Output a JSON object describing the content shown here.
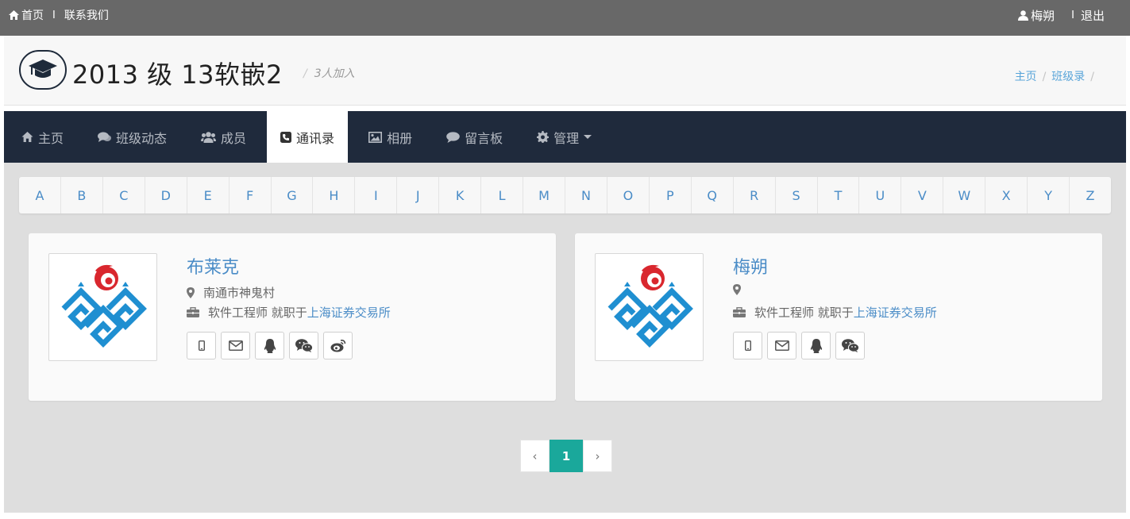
{
  "topbar": {
    "home_label": "首页",
    "separator": "I",
    "contact_label": "联系我们",
    "user_name": "梅朔",
    "logout_label": "退出"
  },
  "header": {
    "title": "2013 级 13软嵌2",
    "subtitle_slash": "/",
    "subtitle": "3人加入",
    "breadcrumb": [
      {
        "label": "主页"
      },
      {
        "label": "班级录"
      }
    ],
    "breadcrumb_sep": "/"
  },
  "nav": {
    "items": [
      {
        "label": "主页",
        "icon": "home-icon"
      },
      {
        "label": "班级动态",
        "icon": "comments-icon"
      },
      {
        "label": "成员",
        "icon": "users-icon"
      },
      {
        "label": "通讯录",
        "icon": "phone-square-icon",
        "active": true
      },
      {
        "label": "相册",
        "icon": "picture-icon"
      },
      {
        "label": "留言板",
        "icon": "comment-icon"
      },
      {
        "label": "管理",
        "icon": "gear-icon",
        "dropdown": true
      }
    ]
  },
  "alphabet": [
    "A",
    "B",
    "C",
    "D",
    "E",
    "F",
    "G",
    "H",
    "I",
    "J",
    "K",
    "L",
    "M",
    "N",
    "O",
    "P",
    "Q",
    "R",
    "S",
    "T",
    "U",
    "V",
    "W",
    "X",
    "Y",
    "Z"
  ],
  "contacts": [
    {
      "name": "布莱克",
      "location": "南通市神鬼村",
      "job": "软件工程师 就职于",
      "company": "上海证券交易所",
      "contact_icons": [
        "mobile-icon",
        "envelope-icon",
        "qq-icon",
        "wechat-icon",
        "weibo-icon"
      ]
    },
    {
      "name": "梅朔",
      "location": "",
      "job": "软件工程师 就职于",
      "company": "上海证券交易所",
      "contact_icons": [
        "mobile-icon",
        "envelope-icon",
        "qq-icon",
        "wechat-icon"
      ]
    }
  ],
  "pagination": {
    "prev": "‹",
    "current": "1",
    "next": "›"
  },
  "colors": {
    "topbar": "#686868",
    "nav": "#1f2a3c",
    "link": "#4a8cc7",
    "pager_active": "#1aa89b",
    "content_bg": "#dedede"
  }
}
